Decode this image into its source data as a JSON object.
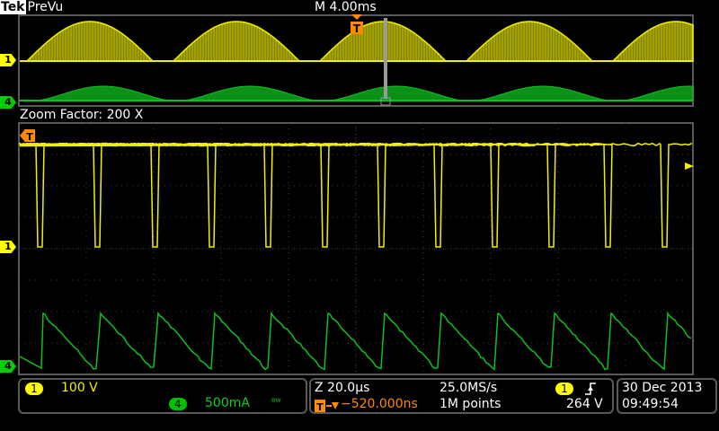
{
  "header": {
    "brand": "Tek",
    "mode": "PreVu",
    "horizontal_position": "M 4.00ms"
  },
  "zoom": {
    "label": "Zoom Factor: 200 X"
  },
  "channel_markers": {
    "ch1": "1",
    "ch4": "4",
    "trigger": "T"
  },
  "channel_readouts": {
    "ch1": {
      "number": "1",
      "scale": "100 V"
    },
    "ch4": {
      "number": "4",
      "scale": "500mA",
      "bw_icon": "ᴮᵂ"
    }
  },
  "timebase": {
    "zoom_scale": "Z 20.0μs",
    "trigger_delay": "−520.000ns",
    "sample_rate": "25.0MS/s",
    "record_length": "1M points",
    "trigger_source": "1",
    "trigger_level": "264 V"
  },
  "datetime": {
    "date": "30 Dec 2013",
    "time": "09:49:54"
  },
  "colors": {
    "ch1": "#f0f000",
    "ch4": "#10c020",
    "grid": "#3a3a3a",
    "frame": "#5a5a5a"
  }
}
